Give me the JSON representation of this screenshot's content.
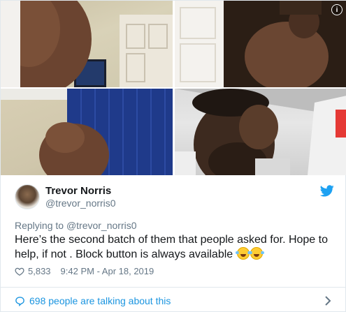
{
  "tweet": {
    "display_name": "Trevor Norris",
    "handle": "@trevor_norris0",
    "reply_prefix": "Replying to",
    "reply_to": "@trevor_norris0",
    "text": "Here’s the second batch of them that people asked for. Hope to help, if not . Block button is always available",
    "likes": "5,833",
    "timestamp": "9:42 PM - Apr 18, 2019",
    "talking_about": "698 people are talking about this"
  },
  "media": {
    "info_icon": "i"
  },
  "colors": {
    "accent": "#1da1f2",
    "link": "#1b95e0",
    "muted": "#657786",
    "text": "#14171a"
  },
  "icons": [
    "twitter-bird-icon",
    "heart-icon",
    "speech-bubble-icon",
    "chevron-right-icon",
    "info-icon",
    "laughing-emoji-icon"
  ]
}
